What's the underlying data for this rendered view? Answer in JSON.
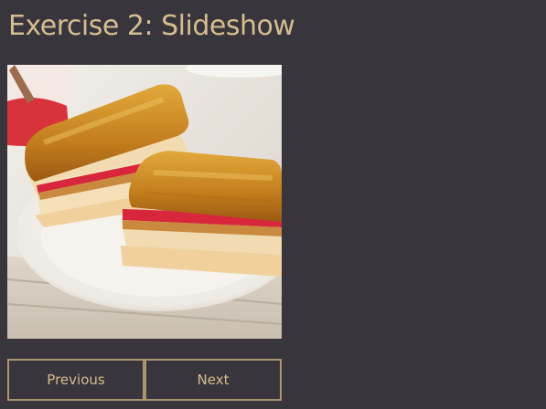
{
  "heading": "Exercise 2: Slideshow",
  "slideshow": {
    "image_alt": "Grilled peanut butter and jelly sandwich on a white plate",
    "previous_label": "Previous",
    "next_label": "Next"
  },
  "colors": {
    "background": "#38353c",
    "accent": "#d4bd8f",
    "button_border": "#a99570"
  }
}
